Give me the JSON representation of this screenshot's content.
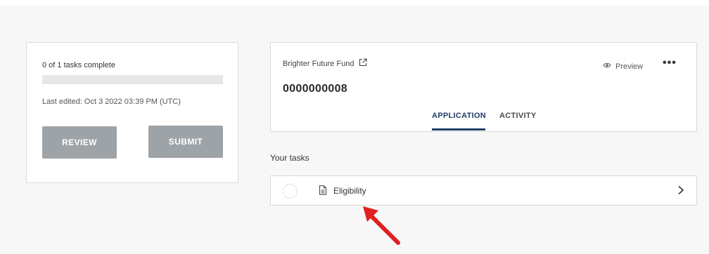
{
  "summary": {
    "tasks_complete": "0 of 1 tasks complete",
    "progress_fraction": 0,
    "last_edited": "Last edited: Oct 3 2022 03:39 PM (UTC)",
    "review_label": "REVIEW",
    "submit_label": "SUBMIT"
  },
  "application": {
    "fund_name": "Brighter Future Fund",
    "id": "0000000008",
    "preview_label": "Preview",
    "more_label": "•••",
    "tabs": [
      {
        "label": "APPLICATION",
        "active": true
      },
      {
        "label": "ACTIVITY",
        "active": false
      }
    ]
  },
  "tasks": {
    "heading": "Your tasks",
    "items": [
      {
        "label": "Eligibility",
        "status": "not-started"
      }
    ]
  },
  "colors": {
    "accent": "#1f3d66",
    "button_disabled": "#9ea3a7",
    "annotation_arrow": "#e02020"
  },
  "icons": {
    "external_link": "external-link-icon",
    "preview": "eye-icon",
    "task_doc": "document-icon",
    "chevron": "chevron-right-icon"
  }
}
